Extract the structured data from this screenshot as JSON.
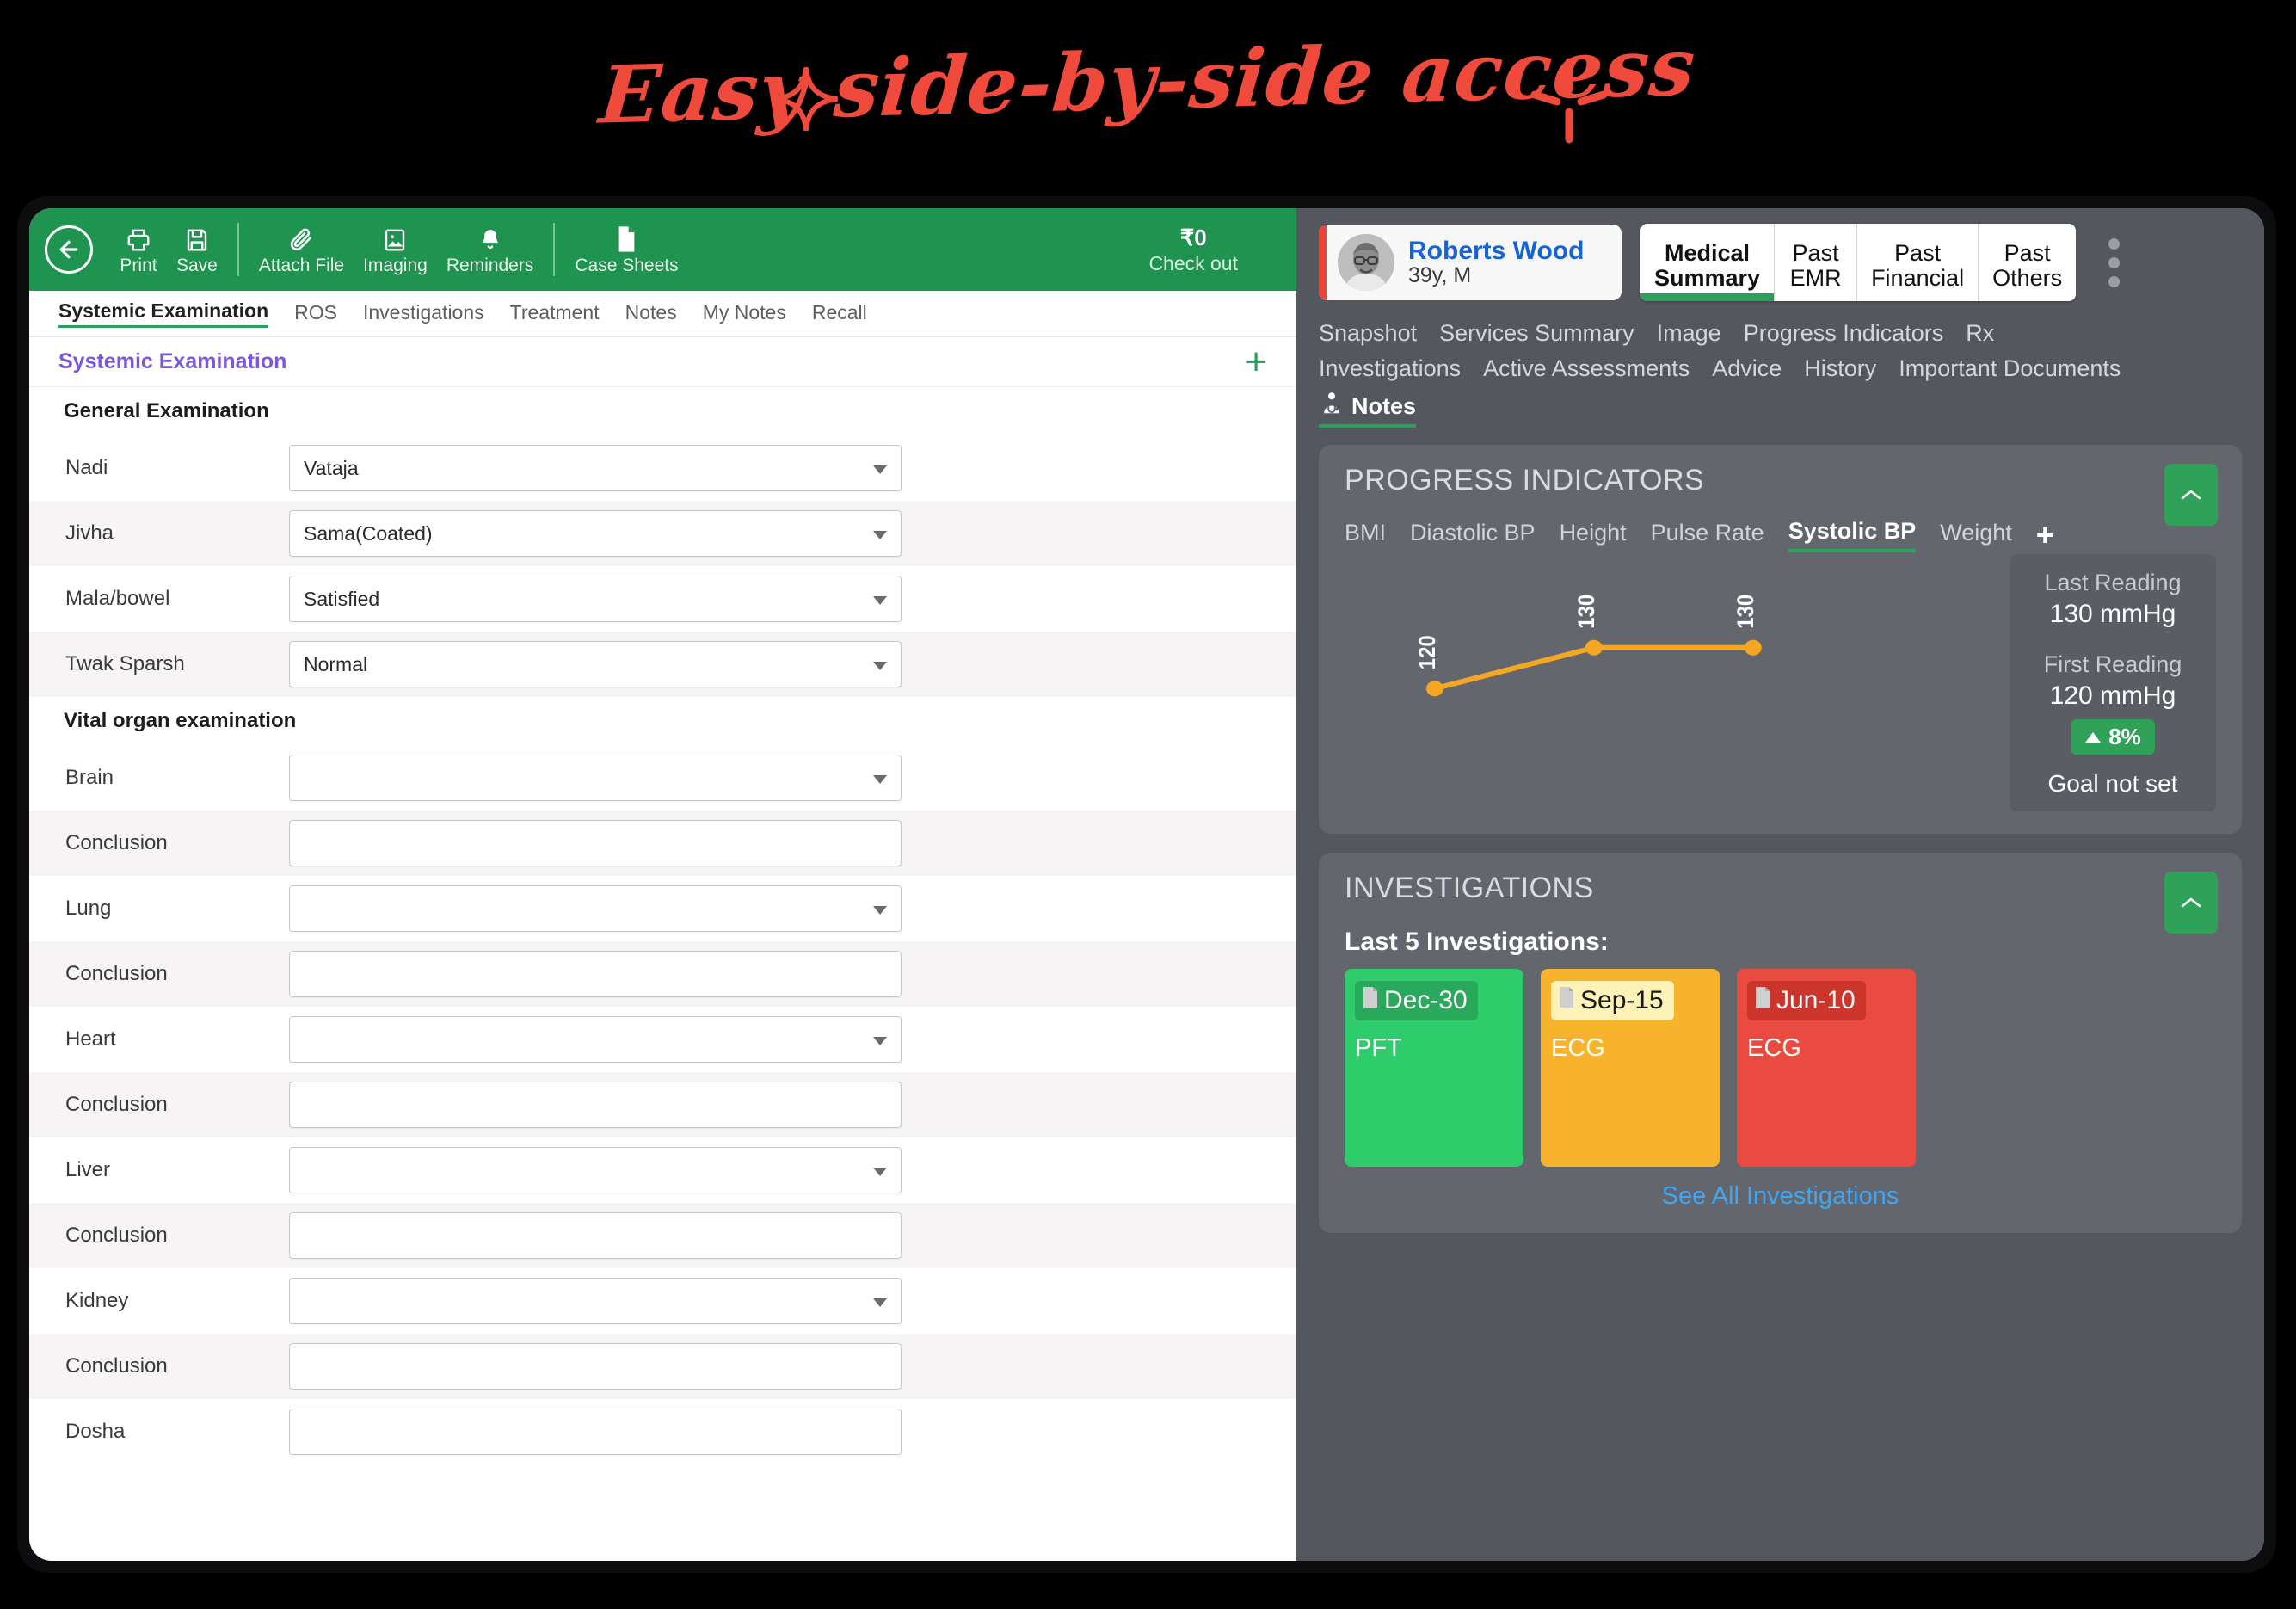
{
  "headline": {
    "text": "Easy side-by-side access"
  },
  "emr": {
    "toolbar": {
      "back_icon": "back-arrow-icon",
      "items": [
        {
          "label": "Print",
          "icon": "printer-icon"
        },
        {
          "label": "Save",
          "icon": "floppy-disk-icon"
        },
        {
          "label": "Attach File",
          "icon": "paperclip-icon"
        },
        {
          "label": "Imaging",
          "icon": "image-icon"
        },
        {
          "label": "Reminders",
          "icon": "bell-icon"
        },
        {
          "label": "Case Sheets",
          "icon": "document-icon"
        }
      ],
      "checkout_amount": "₹0",
      "checkout_label": "Check out"
    },
    "tabs": [
      {
        "label": "Systemic Examination",
        "active": true
      },
      {
        "label": "ROS",
        "active": false
      },
      {
        "label": "Investigations",
        "active": false
      },
      {
        "label": "Treatment",
        "active": false
      },
      {
        "label": "Notes",
        "active": false
      },
      {
        "label": "My Notes",
        "active": false
      },
      {
        "label": "Recall",
        "active": false
      }
    ],
    "section_title": "Systemic Examination",
    "add_icon": "plus-icon",
    "groups": [
      {
        "title": "General Examination",
        "rows": [
          {
            "label": "Nadi",
            "value": "Vataja",
            "type": "select"
          },
          {
            "label": "Jivha",
            "value": "Sama(Coated)",
            "type": "select"
          },
          {
            "label": "Mala/bowel",
            "value": "Satisfied",
            "type": "select"
          },
          {
            "label": "Twak Sparsh",
            "value": "Normal",
            "type": "select"
          }
        ]
      },
      {
        "title": "Vital organ examination",
        "rows": [
          {
            "label": "Brain",
            "value": "",
            "type": "select"
          },
          {
            "label": "Conclusion",
            "value": "",
            "type": "text"
          },
          {
            "label": "Lung",
            "value": "",
            "type": "select"
          },
          {
            "label": "Conclusion",
            "value": "",
            "type": "text"
          },
          {
            "label": "Heart",
            "value": "",
            "type": "select"
          },
          {
            "label": "Conclusion",
            "value": "",
            "type": "text"
          },
          {
            "label": "Liver",
            "value": "",
            "type": "select"
          },
          {
            "label": "Conclusion",
            "value": "",
            "type": "text"
          },
          {
            "label": "Kidney",
            "value": "",
            "type": "select"
          },
          {
            "label": "Conclusion",
            "value": "",
            "type": "text"
          },
          {
            "label": "Dosha",
            "value": "",
            "type": "text"
          }
        ]
      }
    ]
  },
  "summary": {
    "patient": {
      "name": "Roberts Wood",
      "meta": "39y, M",
      "avatar": "patient-avatar"
    },
    "segments": [
      {
        "line1": "Medical",
        "line2": "Summary",
        "active": true
      },
      {
        "line1": "Past",
        "line2": "EMR",
        "active": false
      },
      {
        "line1": "Past",
        "line2": "Financial",
        "active": false
      },
      {
        "line1": "Past",
        "line2": "Others",
        "active": false
      }
    ],
    "kebab_icon": "more-vertical-icon",
    "nav_links": [
      {
        "label": "Snapshot",
        "active": false
      },
      {
        "label": "Services Summary",
        "active": false
      },
      {
        "label": "Image",
        "active": false
      },
      {
        "label": "Progress Indicators",
        "active": false
      },
      {
        "label": "Rx",
        "active": false
      },
      {
        "label": "Investigations",
        "active": false
      },
      {
        "label": "Active Assessments",
        "active": false
      },
      {
        "label": "Advice",
        "active": false
      },
      {
        "label": "History",
        "active": false
      },
      {
        "label": "Important Documents",
        "active": false
      },
      {
        "label": "Notes",
        "active": true,
        "icon": "stethoscope-doctor-icon"
      }
    ],
    "progress": {
      "title": "PROGRESS INDICATORS",
      "collapse_icon": "chevron-up-icon",
      "tabs": [
        {
          "label": "BMI",
          "active": false
        },
        {
          "label": "Diastolic BP",
          "active": false
        },
        {
          "label": "Height",
          "active": false
        },
        {
          "label": "Pulse Rate",
          "active": false
        },
        {
          "label": "Systolic BP",
          "active": true
        },
        {
          "label": "Weight",
          "active": false
        }
      ],
      "add_icon": "plus-icon",
      "reading": {
        "last_label": "Last Reading",
        "last_value": "130 mmHg",
        "first_label": "First Reading",
        "first_value": "120 mmHg",
        "delta": "8%",
        "delta_direction": "up",
        "delta_color": "#2fa158",
        "goal": "Goal not set"
      }
    },
    "investigations": {
      "title": "INVESTIGATIONS",
      "collapse_icon": "chevron-up-icon",
      "subtitle": "Last 5 Investigations:",
      "items": [
        {
          "date": "Dec-30",
          "name": "PFT",
          "color": "#2ecc6a",
          "chip_bg": "#2aa85c",
          "chip_text": "#ffffff"
        },
        {
          "date": "Sep-15",
          "name": "ECG",
          "color": "#f7b32b",
          "chip_bg": "#fdf3b8",
          "chip_text": "#1a1a1a"
        },
        {
          "date": "Jun-10",
          "name": "ECG",
          "color": "#ea4b41",
          "chip_bg": "#cc352c",
          "chip_text": "#ffffff"
        }
      ],
      "see_all": "See All Investigations"
    }
  },
  "chart_data": {
    "type": "line",
    "title": "Systolic BP",
    "series": [
      {
        "name": "Systolic BP",
        "values": [
          120,
          130,
          130
        ],
        "color": "#f5a623"
      }
    ],
    "x": [
      1,
      2,
      3
    ],
    "point_labels": [
      "120",
      "130",
      "130"
    ],
    "ylabel": "mmHg",
    "xlabel": "",
    "ylim": [
      115,
      135
    ],
    "grid": false,
    "legend": "none"
  }
}
